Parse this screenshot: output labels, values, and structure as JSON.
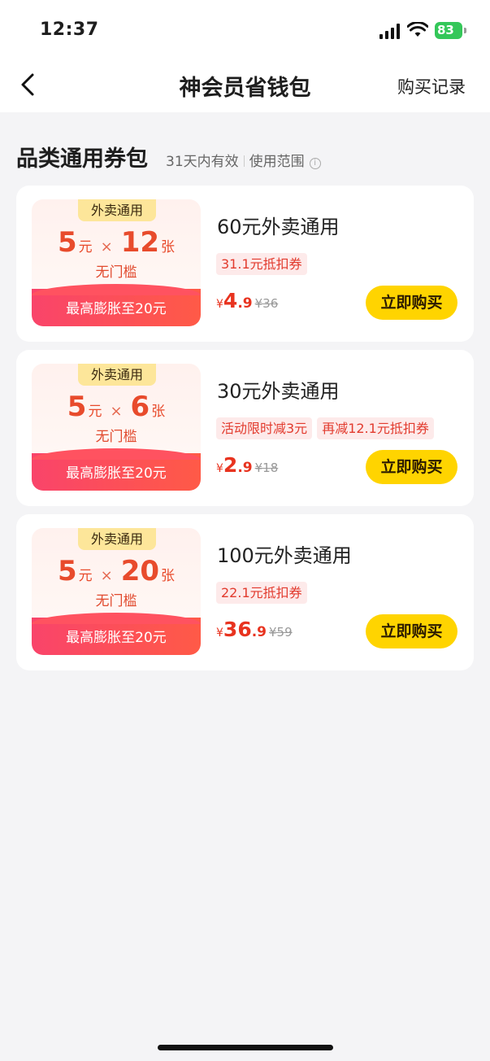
{
  "status_bar": {
    "time": "12:37",
    "battery": "83"
  },
  "nav": {
    "title": "神会员省钱包",
    "action": "购买记录"
  },
  "section": {
    "title": "品类通用券包",
    "validity": "31天内有效",
    "scope": "使用范围",
    "info_icon": "i"
  },
  "cards": [
    {
      "tag": "外卖通用",
      "amount": "5",
      "amount_unit": "元",
      "times": "×",
      "count": "12",
      "count_unit": "张",
      "threshold": "无门槛",
      "boost": "最高膨胀至20元",
      "title": "60元外卖通用",
      "chips": [
        "31.1元抵扣券"
      ],
      "price": {
        "yen": "¥",
        "int": "4",
        "dec": ".9",
        "original": "¥36"
      },
      "button": "立即购买"
    },
    {
      "tag": "外卖通用",
      "amount": "5",
      "amount_unit": "元",
      "times": "×",
      "count": "6",
      "count_unit": "张",
      "threshold": "无门槛",
      "boost": "最高膨胀至20元",
      "title": "30元外卖通用",
      "chips": [
        "活动限时减3元",
        "再减12.1元抵扣券"
      ],
      "price": {
        "yen": "¥",
        "int": "2",
        "dec": ".9",
        "original": "¥18"
      },
      "button": "立即购买"
    },
    {
      "tag": "外卖通用",
      "amount": "5",
      "amount_unit": "元",
      "times": "×",
      "count": "20",
      "count_unit": "张",
      "threshold": "无门槛",
      "boost": "最高膨胀至20元",
      "title": "100元外卖通用",
      "chips": [
        "22.1元抵扣券"
      ],
      "price": {
        "yen": "¥",
        "int": "36",
        "dec": ".9",
        "original": "¥59"
      },
      "button": "立即购买"
    }
  ]
}
